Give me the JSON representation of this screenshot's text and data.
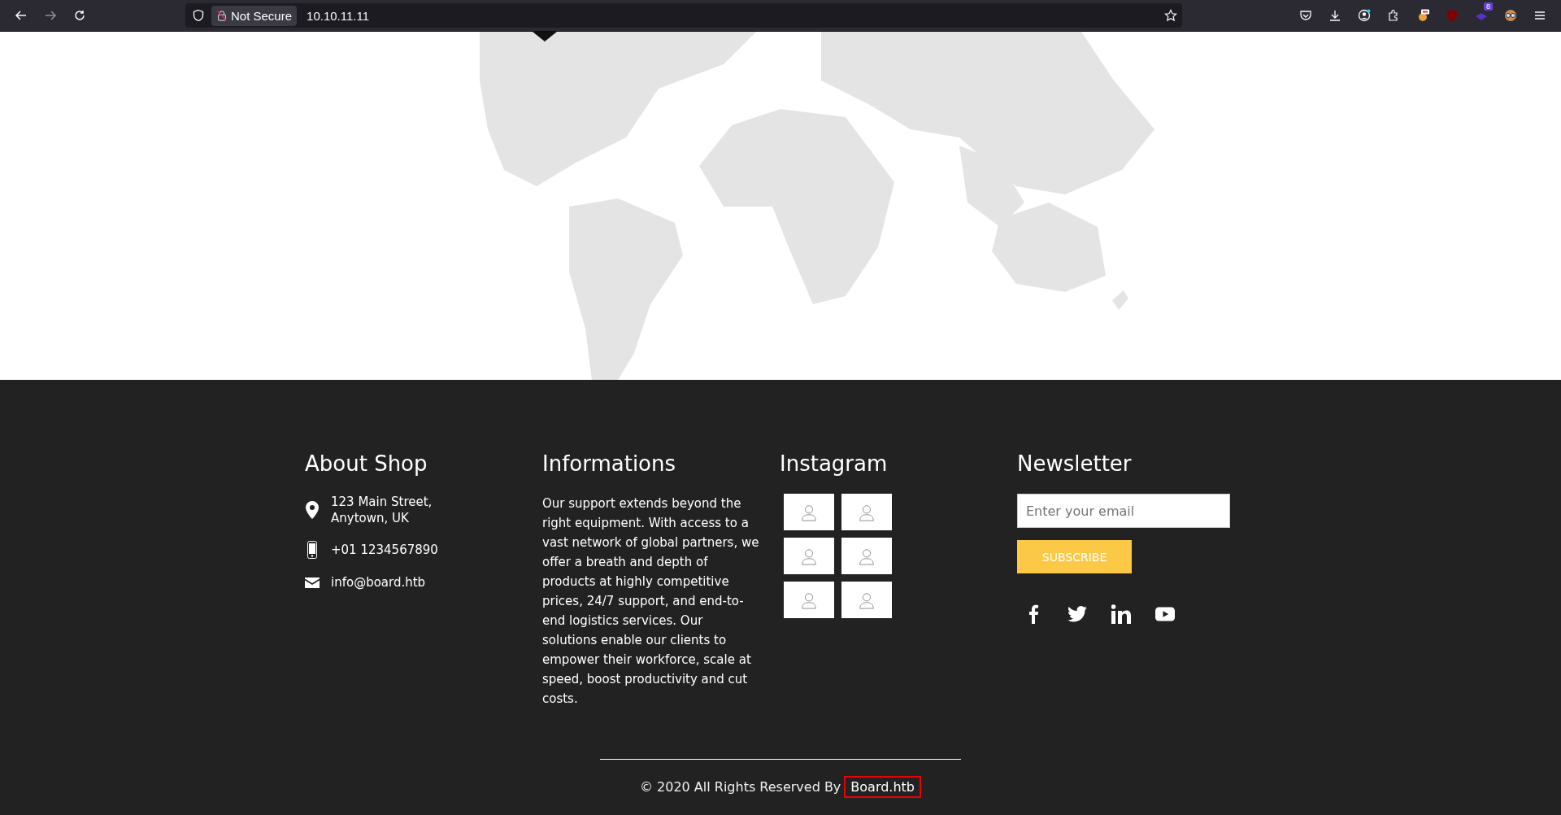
{
  "browser": {
    "security_label": "Not Secure",
    "url": "10.10.11.11",
    "extension_badge": "8"
  },
  "footer": {
    "columns": [
      {
        "kind": "contact",
        "title": "About Shop",
        "items": [
          {
            "kind": "address",
            "lines": [
              "123 Main Street,",
              "Anytown, UK"
            ]
          },
          {
            "kind": "phone",
            "lines": [
              "+01 1234567890"
            ]
          },
          {
            "kind": "email",
            "lines": [
              "info@board.htb"
            ]
          }
        ]
      },
      {
        "kind": "text",
        "title": "Informations",
        "text": "Our support extends beyond the right equipment. With access to a vast network of global partners, we offer a breath and depth of products at highly competitive prices, 24/7 support, and end-to-end logistics services. Our solutions enable our clients to empower their workforce, scale at speed, boost productivity and cut costs."
      },
      {
        "kind": "gallery",
        "title": "Instagram",
        "tiles": [
          {
            "kind": "thumbnail"
          },
          {
            "kind": "thumbnail"
          },
          {
            "kind": "thumbnail"
          },
          {
            "kind": "thumbnail"
          },
          {
            "kind": "thumbnail"
          },
          {
            "kind": "thumbnail"
          }
        ]
      },
      {
        "kind": "newsletter",
        "title": "Newsletter",
        "placeholder": "Enter your email",
        "button": "SUBSCRIBE",
        "socials": [
          {
            "kind": "facebook"
          },
          {
            "kind": "twitter"
          },
          {
            "kind": "linkedin"
          },
          {
            "kind": "youtube"
          }
        ]
      }
    ],
    "copyright": "© 2020 All Rights Reserved By",
    "brand_link": "Board.htb"
  }
}
